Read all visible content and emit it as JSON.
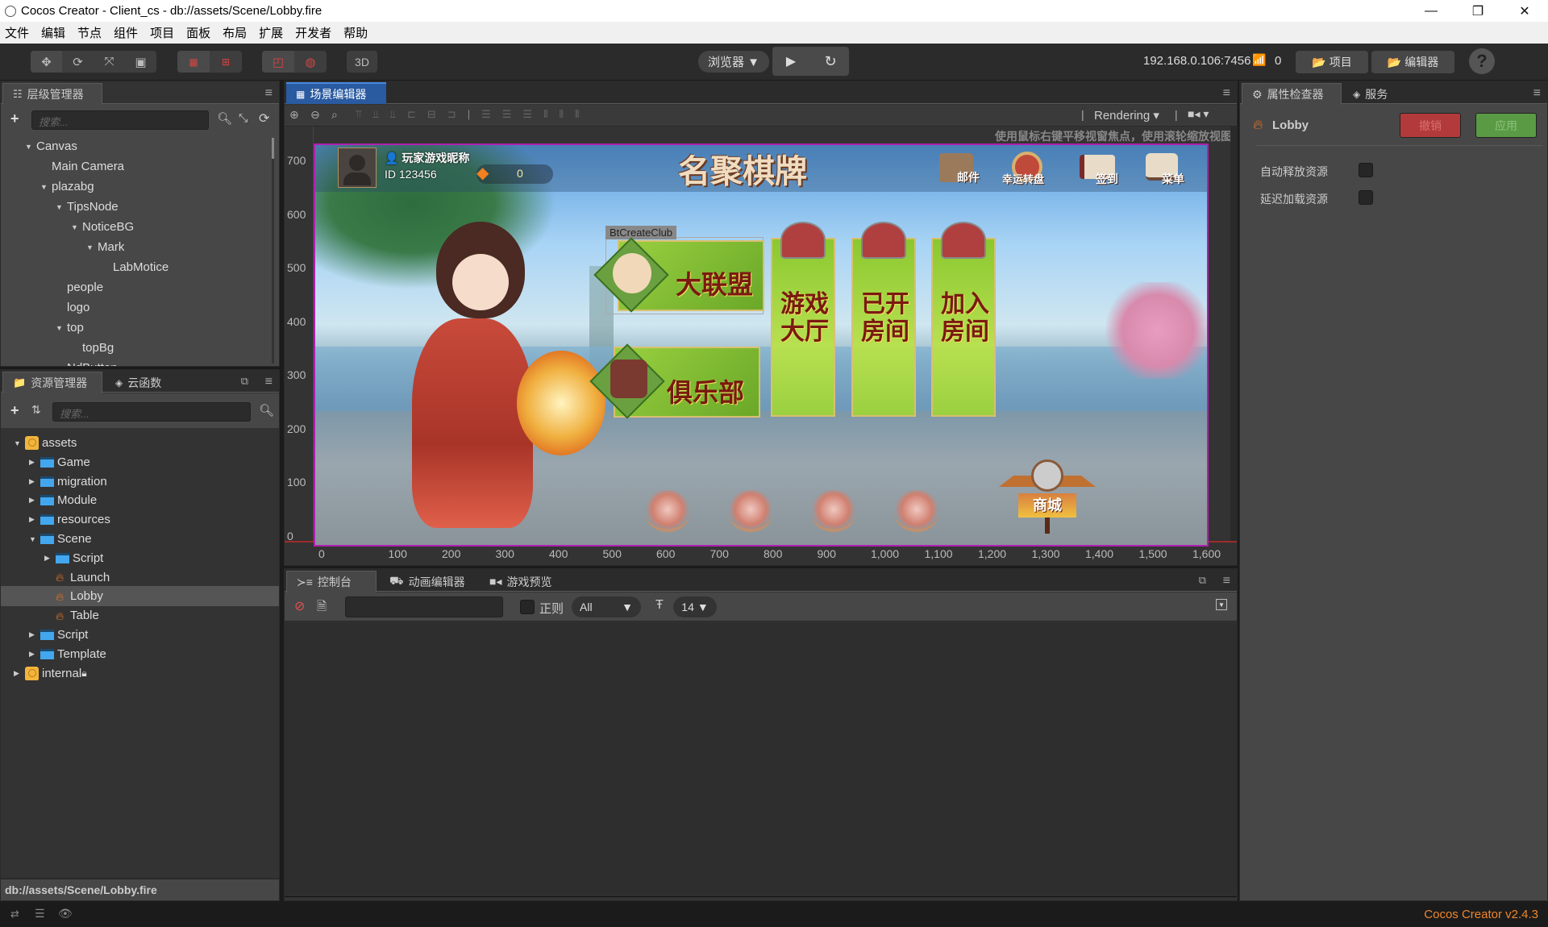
{
  "window": {
    "title": "Cocos Creator - Client_cs - db://assets/Scene/Lobby.fire",
    "controls": {
      "minimize": "—",
      "restore": "❐",
      "close": "✕"
    }
  },
  "menu": [
    "文件",
    "编辑",
    "节点",
    "组件",
    "项目",
    "面板",
    "布局",
    "扩展",
    "开发者",
    "帮助"
  ],
  "toolbar": {
    "transform_tools": [
      "move-tool",
      "rotate-tool",
      "scale-tool",
      "rect-tool"
    ],
    "pivot_tools": [
      "pivot-tool",
      "center-tool"
    ],
    "coord_tools": [
      "local-tool",
      "global-tool"
    ],
    "mode_3d": "3D",
    "preview_target": "浏览器 ▼",
    "play": "▶",
    "refresh": "↻",
    "server_address": "192.168.0.106:7456",
    "connected_count": "0",
    "project_button": "项目",
    "editor_button": "编辑器",
    "help": "?"
  },
  "hierarchy": {
    "title": "层级管理器",
    "search_placeholder": "搜索...",
    "nodes": [
      {
        "label": "Canvas",
        "depth": 0,
        "expanded": true
      },
      {
        "label": "Main Camera",
        "depth": 1,
        "expanded": null
      },
      {
        "label": "plazabg",
        "depth": 1,
        "expanded": true
      },
      {
        "label": "TipsNode",
        "depth": 2,
        "expanded": true
      },
      {
        "label": "NoticeBG",
        "depth": 3,
        "expanded": true
      },
      {
        "label": "Mark",
        "depth": 4,
        "expanded": true
      },
      {
        "label": "LabMotice",
        "depth": 5,
        "expanded": null
      },
      {
        "label": "people",
        "depth": 2,
        "expanded": null
      },
      {
        "label": "logo",
        "depth": 2,
        "expanded": null
      },
      {
        "label": "top",
        "depth": 2,
        "expanded": true
      },
      {
        "label": "topBg",
        "depth": 3,
        "expanded": null
      },
      {
        "label": "NdButton",
        "depth": 2,
        "expanded": true
      }
    ]
  },
  "assets": {
    "title": "资源管理器",
    "tab2": "云函数",
    "search_placeholder": "搜索...",
    "items": [
      {
        "label": "assets",
        "depth": 0,
        "type": "db",
        "expanded": true
      },
      {
        "label": "Game",
        "depth": 1,
        "type": "folder",
        "expanded": false
      },
      {
        "label": "migration",
        "depth": 1,
        "type": "folder",
        "expanded": false
      },
      {
        "label": "Module",
        "depth": 1,
        "type": "folder",
        "expanded": false
      },
      {
        "label": "resources",
        "depth": 1,
        "type": "folder",
        "expanded": false
      },
      {
        "label": "Scene",
        "depth": 1,
        "type": "folder",
        "expanded": true
      },
      {
        "label": "Script",
        "depth": 2,
        "type": "folder",
        "expanded": false
      },
      {
        "label": "Launch",
        "depth": 2,
        "type": "scene",
        "expanded": null
      },
      {
        "label": "Lobby",
        "depth": 2,
        "type": "scene",
        "expanded": null,
        "selected": true
      },
      {
        "label": "Table",
        "depth": 2,
        "type": "scene",
        "expanded": null
      },
      {
        "label": "Script",
        "depth": 1,
        "type": "folder",
        "expanded": false
      },
      {
        "label": "Template",
        "depth": 1,
        "type": "folder",
        "expanded": false
      },
      {
        "label": "internal",
        "depth": 0,
        "type": "db",
        "expanded": false,
        "locked": true
      }
    ],
    "selected_path": "db://assets/Scene/Lobby.fire"
  },
  "scene_editor": {
    "title": "场景编辑器",
    "rendering_label": "Rendering",
    "hint": "使用鼠标右键平移视窗焦点，使用滚轮缩放视图",
    "ruler_y": [
      "700",
      "600",
      "500",
      "400",
      "300",
      "200",
      "100",
      "0"
    ],
    "ruler_x": [
      "0",
      "100",
      "200",
      "300",
      "400",
      "500",
      "600",
      "700",
      "800",
      "900",
      "1,000",
      "1,100",
      "1,200",
      "1,300",
      "1,400",
      "1,500",
      "1,600"
    ],
    "selected_node_label": "BtCreateClub",
    "game": {
      "player_name": "玩家游戏昵称",
      "player_id": "ID 123456",
      "diamonds": "0",
      "logo_text": "名聚棋牌",
      "top_icons": [
        "邮件",
        "幸运转盘",
        "签到",
        "菜单"
      ],
      "left_buttons": [
        "大联盟",
        "俱乐部"
      ],
      "vertical_buttons": [
        "游戏大厅",
        "已开房间",
        "加入房间"
      ],
      "shop": "商城"
    }
  },
  "console": {
    "tabs": [
      "控制台",
      "动画编辑器",
      "游戏预览"
    ],
    "regex_label": "正则",
    "filter_level": "All",
    "font_size": "14"
  },
  "inspector": {
    "title": "属性检查器",
    "tab2": "服务",
    "asset_name": "Lobby",
    "revert_button": "撤销",
    "apply_button": "应用",
    "properties": [
      {
        "label": "自动释放资源",
        "checked": false
      },
      {
        "label": "延迟加载资源",
        "checked": false
      }
    ]
  },
  "statusbar": {
    "version": "Cocos Creator v2.4.3"
  },
  "colors": {
    "accent_blue": "#2a5aa0",
    "revert_red": "#b33a3a",
    "apply_green": "#5a9a44",
    "version_orange": "#f0862a",
    "scene_border": "#b020b0"
  }
}
